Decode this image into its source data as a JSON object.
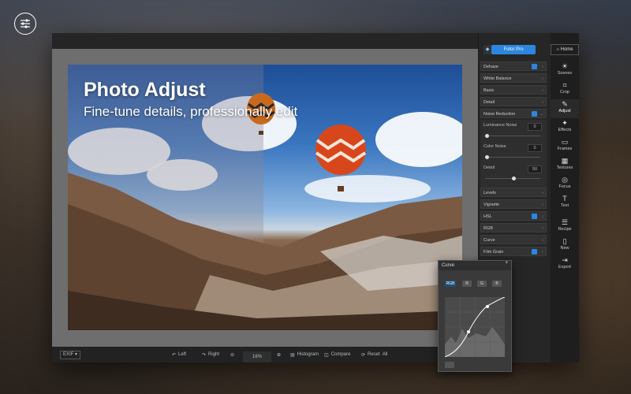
{
  "promo": {
    "icon": "sliders-icon"
  },
  "photo": {
    "title": "Photo Adjust",
    "subtitle": "Fine-tune details, professionally edit"
  },
  "bottombar": {
    "exif": "EXIF ▾",
    "left": "Left",
    "right": "Right",
    "zoom": "16%",
    "histogram": "Histogram",
    "compare": "Compare",
    "reset": "Reset",
    "all": "All"
  },
  "panel": {
    "pro": "Fotor Pro",
    "home": "Home",
    "rows": [
      "Dehaze",
      "White Balance",
      "Basic",
      "Detail",
      "Noise Reduction"
    ],
    "luminance": {
      "label": "Luminance Noise",
      "value": "0"
    },
    "color": {
      "label": "Color Noise",
      "value": "0"
    },
    "detail": {
      "label": "Detail",
      "value": "50"
    },
    "rows2": [
      "Levels",
      "Vignette",
      "HSL",
      "RGB",
      "Curve",
      "Film Grain"
    ]
  },
  "tools": [
    "Scenes",
    "Crop",
    "Adjust",
    "Effects",
    "Frames",
    "Textures",
    "Focus",
    "Text",
    "Recipe",
    "New",
    "Export"
  ],
  "curve": {
    "title": "Curve",
    "channels": [
      "RGB",
      "R",
      "G",
      "B"
    ]
  },
  "colors": {
    "accent": "#2b86e0"
  }
}
